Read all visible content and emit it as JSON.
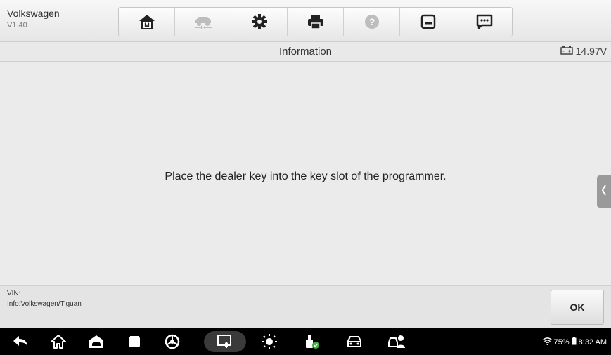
{
  "app": {
    "name": "Volkswagen",
    "version": "V1.40"
  },
  "toolbar": {
    "buttons": [
      {
        "icon": "home-icon"
      },
      {
        "icon": "vehicle-swap-icon"
      },
      {
        "icon": "gear-icon"
      },
      {
        "icon": "printer-icon"
      },
      {
        "icon": "help-icon"
      },
      {
        "icon": "save-icon"
      },
      {
        "icon": "message-icon"
      }
    ]
  },
  "titlebar": {
    "title": "Information",
    "voltage": "14.97V",
    "battery_icon": "battery-icon"
  },
  "content": {
    "message": "Place the dealer key into the key slot of the programmer."
  },
  "footer": {
    "vin_label": "VIN:",
    "info": "Info:Volkswagen/Tiguan",
    "ok_label": "OK"
  },
  "status": {
    "battery": "75%",
    "time": "8:32 AM"
  },
  "colors": {
    "nav_bg": "#000000",
    "page_bg": "#ebebeb",
    "side_tab": "#9a9a9a"
  }
}
